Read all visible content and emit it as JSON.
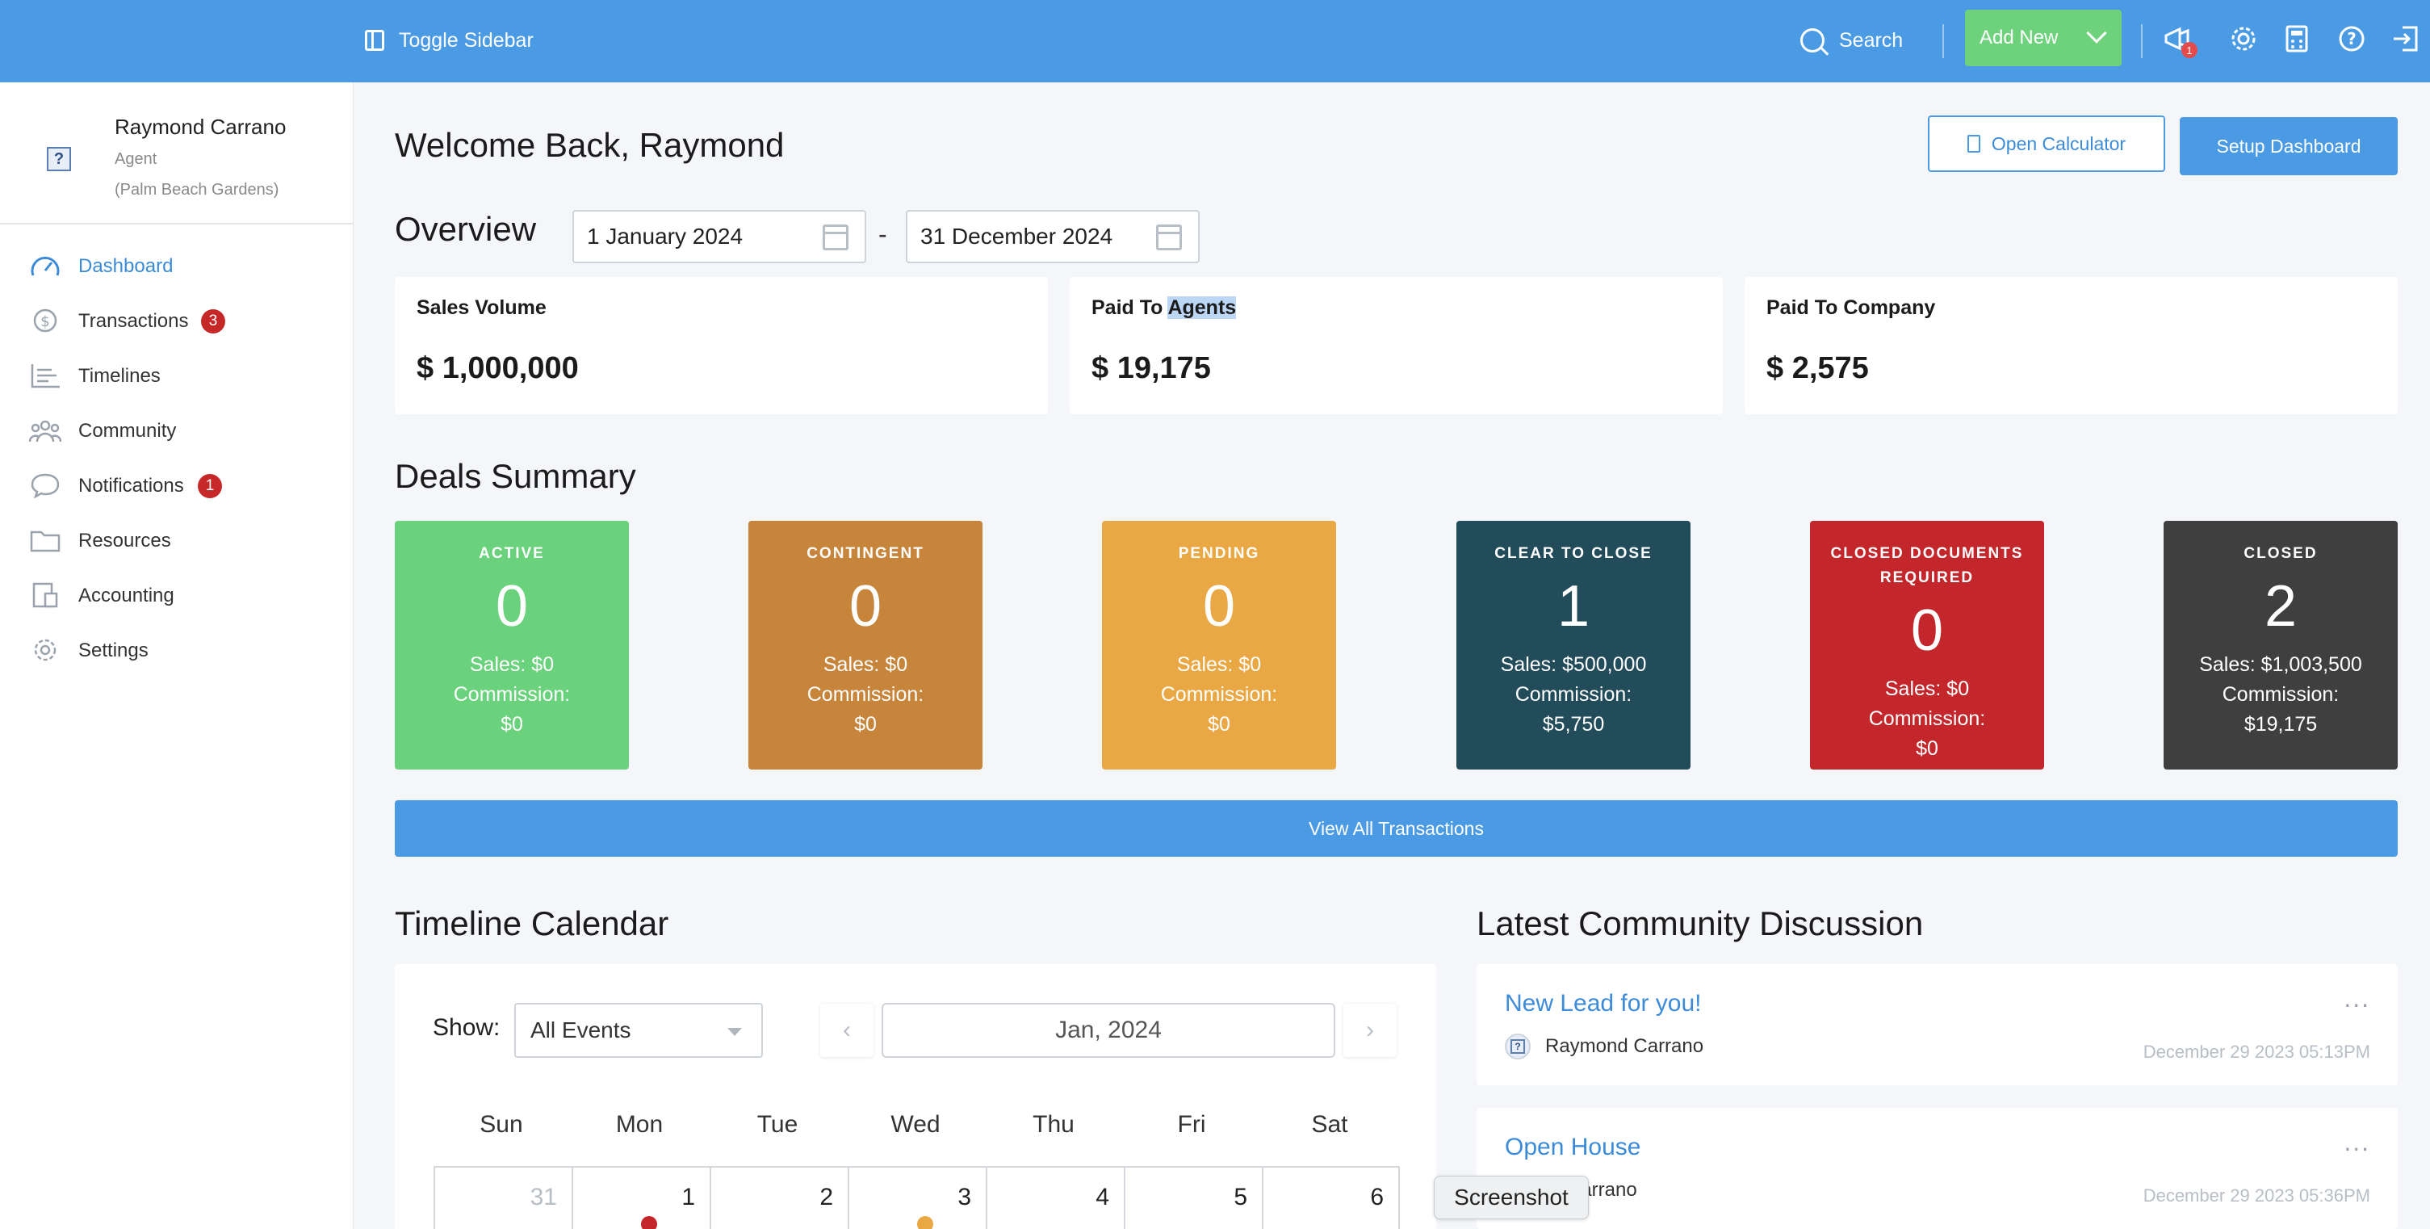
{
  "topbar": {
    "toggle_label": "Toggle Sidebar",
    "search_label": "Search",
    "add_new_label": "Add New",
    "notification_count": "1",
    "icons": [
      "megaphone-icon",
      "gear-icon",
      "calculator-icon",
      "help-icon",
      "logout-icon"
    ]
  },
  "user": {
    "name": "Raymond Carrano",
    "role": "Agent",
    "office": "(Palm Beach Gardens)",
    "avatar_glyph": "?"
  },
  "nav": [
    {
      "label": "Dashboard",
      "icon": "speedometer-icon",
      "active": true
    },
    {
      "label": "Transactions",
      "icon": "dollar-icon",
      "badge": "3"
    },
    {
      "label": "Timelines",
      "icon": "timeline-icon"
    },
    {
      "label": "Community",
      "icon": "people-icon"
    },
    {
      "label": "Notifications",
      "icon": "chat-icon",
      "badge": "1"
    },
    {
      "label": "Resources",
      "icon": "folder-icon"
    },
    {
      "label": "Accounting",
      "icon": "ledger-icon"
    },
    {
      "label": "Settings",
      "icon": "gear-icon"
    }
  ],
  "header": {
    "welcome": "Welcome Back, Raymond",
    "open_calculator": "Open Calculator",
    "setup_dashboard": "Setup Dashboard"
  },
  "overview": {
    "title": "Overview",
    "start_date": "1 January 2024",
    "end_date": "31 December 2024",
    "separator": "-",
    "cards": [
      {
        "title": "Sales Volume",
        "value": "$ 1,000,000"
      },
      {
        "title_pre": "Paid To ",
        "title_highlight": "Agents",
        "value": "$ 19,175"
      },
      {
        "title": "Paid To Company",
        "value": "$ 2,575"
      }
    ]
  },
  "deals": {
    "title": "Deals Summary",
    "items": [
      {
        "label": "ACTIVE",
        "count": "0",
        "sales": "Sales: $0",
        "commission_label": "Commission:",
        "commission": "$0",
        "color": "#6ad27c"
      },
      {
        "label": "CONTINGENT",
        "count": "0",
        "sales": "Sales: $0",
        "commission_label": "Commission:",
        "commission": "$0",
        "color": "#c7843b"
      },
      {
        "label": "PENDING",
        "count": "0",
        "sales": "Sales: $0",
        "commission_label": "Commission:",
        "commission": "$0",
        "color": "#eaa845"
      },
      {
        "label": "CLEAR TO CLOSE",
        "count": "1",
        "sales": "Sales: $500,000",
        "commission_label": "Commission:",
        "commission": "$5,750",
        "color": "#224c5a"
      },
      {
        "label_line1": "CLOSED DOCUMENTS",
        "label_line2": "REQUIRED",
        "count": "0",
        "sales": "Sales: $0",
        "commission_label": "Commission:",
        "commission": "$0",
        "color": "#c4272b"
      },
      {
        "label": "CLOSED",
        "count": "2",
        "sales": "Sales: $1,003,500",
        "commission_label": "Commission:",
        "commission": "$19,175",
        "color": "#3f3f3f"
      }
    ],
    "view_all": "View All Transactions"
  },
  "timeline": {
    "title": "Timeline Calendar",
    "show_label": "Show:",
    "filter_value": "All Events",
    "month": "Jan, 2024",
    "prev": "‹",
    "next": "›",
    "weekdays": [
      "Sun",
      "Mon",
      "Tue",
      "Wed",
      "Thu",
      "Fri",
      "Sat"
    ],
    "first_row": [
      "31",
      "1",
      "2",
      "3",
      "4",
      "5",
      "6"
    ],
    "event_dot_colors": {
      "mon": "#c4272b",
      "wed": "#eaa845"
    }
  },
  "community": {
    "title": "Latest Community Discussion",
    "posts": [
      {
        "title": "New Lead for you!",
        "author": "Raymond Carrano",
        "date": "December 29 2023 05:13PM",
        "more": "..."
      },
      {
        "title": "Open House",
        "author": "Carrano",
        "date": "December 29 2023 05:36PM",
        "more": "..."
      }
    ]
  },
  "tooltip": "Screenshot"
}
